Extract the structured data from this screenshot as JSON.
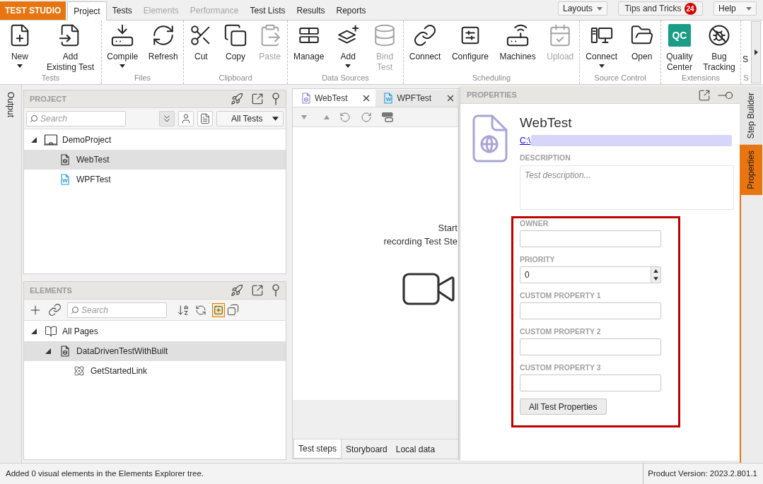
{
  "app_button": {
    "label": "TEST STUDIO"
  },
  "menu_tabs": [
    {
      "label": "Project",
      "selected": true,
      "disabled": false
    },
    {
      "label": "Tests",
      "selected": false,
      "disabled": false
    },
    {
      "label": "Elements",
      "selected": false,
      "disabled": true
    },
    {
      "label": "Performance",
      "selected": false,
      "disabled": true
    },
    {
      "label": "Test Lists",
      "selected": false,
      "disabled": false
    },
    {
      "label": "Results",
      "selected": false,
      "disabled": false
    },
    {
      "label": "Reports",
      "selected": false,
      "disabled": false
    }
  ],
  "top_buttons": {
    "layouts": {
      "label": "Layouts"
    },
    "tips": {
      "label": "Tips and Tricks",
      "badge": "24"
    },
    "help": {
      "label": "Help"
    }
  },
  "ribbon": {
    "groups": [
      {
        "label": "Tests",
        "items": [
          {
            "label": "New",
            "dropdown": true,
            "disabled": false
          },
          {
            "label": "Add\nExisting Test",
            "dropdown": false,
            "disabled": false
          }
        ]
      },
      {
        "label": "Files",
        "items": [
          {
            "label": "Compile",
            "dropdown": true,
            "disabled": false
          },
          {
            "label": "Refresh",
            "dropdown": false,
            "disabled": false
          }
        ]
      },
      {
        "label": "Clipboard",
        "items": [
          {
            "label": "Cut",
            "dropdown": false,
            "disabled": false
          },
          {
            "label": "Copy",
            "dropdown": false,
            "disabled": false
          },
          {
            "label": "Paste",
            "dropdown": false,
            "disabled": true
          }
        ]
      },
      {
        "label": "Data Sources",
        "items": [
          {
            "label": "Manage",
            "dropdown": false,
            "disabled": false
          },
          {
            "label": "Add",
            "dropdown": true,
            "disabled": false
          },
          {
            "label": "Bind\nTest",
            "dropdown": false,
            "disabled": true
          }
        ]
      },
      {
        "label": "Scheduling",
        "items": [
          {
            "label": "Connect",
            "dropdown": false,
            "disabled": false
          },
          {
            "label": "Configure",
            "dropdown": false,
            "disabled": false
          },
          {
            "label": "Machines",
            "dropdown": false,
            "disabled": false
          },
          {
            "label": "Upload",
            "dropdown": false,
            "disabled": true
          }
        ]
      },
      {
        "label": "Source Control",
        "items": [
          {
            "label": "Connect",
            "dropdown": true,
            "disabled": false
          },
          {
            "label": "Open",
            "dropdown": false,
            "disabled": false
          }
        ]
      },
      {
        "label": "Extensions",
        "items": [
          {
            "label": "Quality\nCenter",
            "dropdown": false,
            "disabled": false,
            "logo_text": "QC"
          },
          {
            "label": "Bug\nTracking",
            "dropdown": false,
            "disabled": false
          }
        ]
      },
      {
        "label": "S",
        "items": [
          {
            "label": "S",
            "dropdown": false,
            "disabled": false
          }
        ]
      }
    ]
  },
  "left_side_tabs": [
    {
      "label": "Output",
      "selected": false
    }
  ],
  "project_panel": {
    "title": "PROJECT",
    "search": {
      "placeholder": "Search"
    },
    "filter": {
      "value": "All Tests"
    },
    "tree": [
      {
        "label": "DemoProject",
        "kind": "project",
        "selected": false,
        "expanded": true,
        "children": [
          {
            "label": "WebTest",
            "kind": "web-test",
            "selected": true
          },
          {
            "label": "WPFTest",
            "kind": "wpf-test",
            "selected": false,
            "icon_letter": "W"
          }
        ]
      }
    ]
  },
  "elements_panel": {
    "title": "ELEMENTS",
    "search": {
      "placeholder": "Search"
    },
    "highlight_toggle": {
      "on": true
    },
    "tree": [
      {
        "label": "All Pages",
        "kind": "page-group",
        "selected": false,
        "expanded": true,
        "children": [
          {
            "label": "DataDrivenTestWithBuilt",
            "kind": "page",
            "selected": true,
            "expanded": true,
            "children": [
              {
                "label": "GetStartedLink",
                "kind": "element",
                "selected": false
              }
            ]
          }
        ]
      }
    ]
  },
  "document": {
    "tabs": [
      {
        "label": "WebTest",
        "kind": "web",
        "selected": true
      },
      {
        "label": "WPFTest",
        "kind": "wpf",
        "selected": false,
        "icon_letter": "W"
      }
    ],
    "empty_message": "Start\nrecording Test Ste",
    "bottom_tabs": [
      {
        "label": "Test steps",
        "selected": true
      },
      {
        "label": "Storyboard",
        "selected": false
      },
      {
        "label": "Local data",
        "selected": false
      }
    ]
  },
  "properties": {
    "title": "PROPERTIES",
    "test_name": "WebTest",
    "path_link": "C:\\",
    "description": {
      "label": "DESCRIPTION",
      "placeholder": "Test description..."
    },
    "fields": [
      {
        "label": "OWNER",
        "kind": "text"
      },
      {
        "label": "PRIORITY",
        "kind": "number",
        "value": "0"
      },
      {
        "label": "CUSTOM PROPERTY 1",
        "kind": "text"
      },
      {
        "label": "CUSTOM PROPERTY 2",
        "kind": "text"
      },
      {
        "label": "CUSTOM PROPERTY 3",
        "kind": "text"
      }
    ],
    "button": "All Test Properties"
  },
  "right_side_tabs": [
    {
      "label": "Step Builder",
      "selected": false
    },
    {
      "label": "Properties",
      "selected": true
    }
  ],
  "status_bar": {
    "message": "Added 0 visual elements in the Elements Explorer tree.",
    "version": "Product Version: 2023.2.801.1"
  }
}
